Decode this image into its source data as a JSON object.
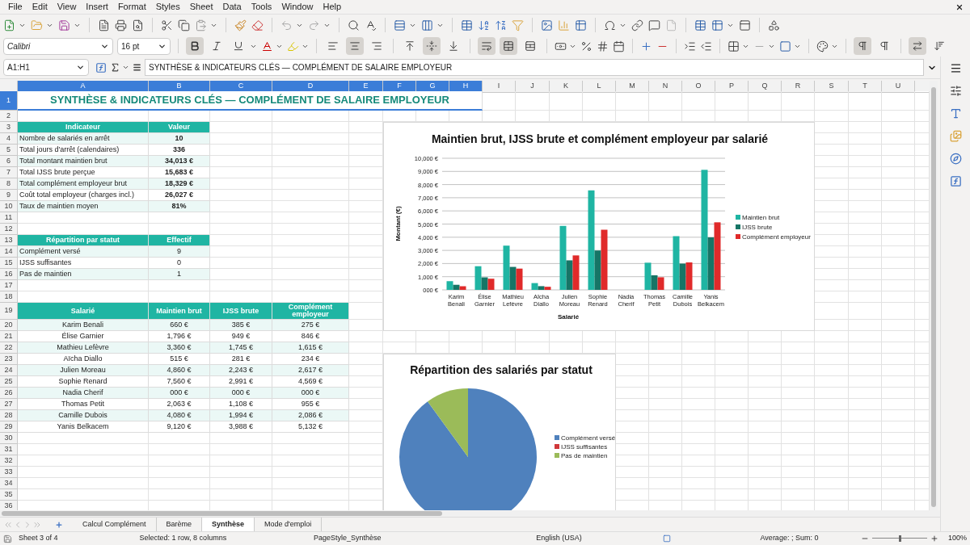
{
  "menu": [
    "File",
    "Edit",
    "View",
    "Insert",
    "Format",
    "Styles",
    "Sheet",
    "Data",
    "Tools",
    "Window",
    "Help"
  ],
  "font_name": "Calibri",
  "font_size": "16 pt",
  "format_buttons": [
    {
      "kind": "bold",
      "pressed": true
    },
    {
      "kind": "italic",
      "pressed": false
    },
    {
      "kind": "underline",
      "pressed": false
    },
    {
      "kind": "align_left",
      "pressed": false
    },
    {
      "kind": "align_center",
      "pressed": true
    },
    {
      "kind": "align_right",
      "pressed": false
    },
    {
      "kind": "align_top",
      "pressed": false
    },
    {
      "kind": "align_middle",
      "pressed": true
    },
    {
      "kind": "align_bottom",
      "pressed": false
    },
    {
      "kind": "wrap",
      "pressed": true
    },
    {
      "kind": "merge",
      "pressed": true
    },
    {
      "kind": "unmerge",
      "pressed": false
    },
    {
      "kind": "ltr",
      "pressed": true
    },
    {
      "kind": "rtl",
      "pressed": false
    },
    {
      "kind": "text_ltr",
      "pressed": true
    },
    {
      "kind": "text_ttb",
      "pressed": false
    }
  ],
  "name_box": "A1:H1",
  "formula": "SYNTHÈSE & INDICATEURS CLÉS — COMPLÉMENT DE SALAIRE EMPLOYEUR",
  "columns": [
    {
      "label": "A",
      "selected": true
    },
    {
      "label": "B",
      "selected": true
    },
    {
      "label": "C",
      "selected": true
    },
    {
      "label": "D",
      "selected": true
    },
    {
      "label": "E",
      "selected": true
    },
    {
      "label": "F",
      "selected": true
    },
    {
      "label": "G",
      "selected": true
    },
    {
      "label": "H",
      "selected": true
    },
    {
      "label": "I",
      "selected": false
    },
    {
      "label": "J",
      "selected": false
    },
    {
      "label": "K",
      "selected": false
    },
    {
      "label": "L",
      "selected": false
    },
    {
      "label": "M",
      "selected": false
    },
    {
      "label": "N",
      "selected": false
    },
    {
      "label": "O",
      "selected": false
    },
    {
      "label": "P",
      "selected": false
    },
    {
      "label": "Q",
      "selected": false
    },
    {
      "label": "R",
      "selected": false
    },
    {
      "label": "S",
      "selected": false
    },
    {
      "label": "T",
      "selected": false
    },
    {
      "label": "U",
      "selected": false
    }
  ],
  "rows": [
    {
      "label": "1",
      "selected": true
    },
    {
      "label": "2",
      "selected": false
    },
    {
      "label": "3",
      "selected": false
    },
    {
      "label": "4",
      "selected": false
    },
    {
      "label": "5",
      "selected": false
    },
    {
      "label": "6",
      "selected": false
    },
    {
      "label": "7",
      "selected": false
    },
    {
      "label": "8",
      "selected": false
    },
    {
      "label": "9",
      "selected": false
    },
    {
      "label": "10",
      "selected": false
    },
    {
      "label": "11",
      "selected": false
    },
    {
      "label": "12",
      "selected": false
    },
    {
      "label": "13",
      "selected": false
    },
    {
      "label": "14",
      "selected": false
    },
    {
      "label": "15",
      "selected": false
    },
    {
      "label": "16",
      "selected": false
    },
    {
      "label": "17",
      "selected": false
    },
    {
      "label": "18",
      "selected": false
    },
    {
      "label": "19",
      "selected": false
    },
    {
      "label": "20",
      "selected": false
    },
    {
      "label": "21",
      "selected": false
    },
    {
      "label": "22",
      "selected": false
    },
    {
      "label": "23",
      "selected": false
    },
    {
      "label": "24",
      "selected": false
    },
    {
      "label": "25",
      "selected": false
    },
    {
      "label": "26",
      "selected": false
    },
    {
      "label": "27",
      "selected": false
    },
    {
      "label": "28",
      "selected": false
    },
    {
      "label": "29",
      "selected": false
    },
    {
      "label": "30",
      "selected": false
    },
    {
      "label": "31",
      "selected": false
    },
    {
      "label": "32",
      "selected": false
    },
    {
      "label": "33",
      "selected": false
    },
    {
      "label": "34",
      "selected": false
    },
    {
      "label": "35",
      "selected": false
    },
    {
      "label": "36",
      "selected": false
    }
  ],
  "title": "SYNTHÈSE & INDICATEURS CLÉS — COMPLÉMENT DE SALAIRE EMPLOYEUR",
  "indicators": {
    "header": [
      "Indicateur",
      "Valeur"
    ],
    "rows": [
      {
        "label": "Nombre de salariés en arrêt",
        "value": "10"
      },
      {
        "label": "Total jours d'arrêt (calendaires)",
        "value": "336"
      },
      {
        "label": "Total montant maintien brut",
        "value": "34,013 €"
      },
      {
        "label": "Total IJSS brute perçue",
        "value": "15,683 €"
      },
      {
        "label": "Total complément employeur brut",
        "value": "18,329 €"
      },
      {
        "label": "Coût total employeur (charges incl.)",
        "value": "26,027 €"
      },
      {
        "label": "Taux de maintien moyen",
        "value": "81%"
      }
    ]
  },
  "status_table": {
    "header": [
      "Répartition par statut",
      "Effectif"
    ],
    "rows": [
      {
        "label": "Complément versé",
        "value": "9"
      },
      {
        "label": "IJSS suffisantes",
        "value": "0"
      },
      {
        "label": "Pas de maintien",
        "value": "1"
      }
    ]
  },
  "salaries": {
    "header": [
      "Salarié",
      "Maintien brut",
      "IJSS brute",
      "Complément employeur"
    ],
    "rows": [
      [
        "Karim Benali",
        "660 €",
        "385 €",
        "275 €"
      ],
      [
        "Élise Garnier",
        "1,796 €",
        "949 €",
        "846 €"
      ],
      [
        "Mathieu Lefèvre",
        "3,360 €",
        "1,745 €",
        "1,615 €"
      ],
      [
        "Aïcha Diallo",
        "515 €",
        "281 €",
        "234 €"
      ],
      [
        "Julien Moreau",
        "4,860 €",
        "2,243 €",
        "2,617 €"
      ],
      [
        "Sophie Renard",
        "7,560 €",
        "2,991 €",
        "4,569 €"
      ],
      [
        "Nadia Cherif",
        "000 €",
        "000 €",
        "000 €"
      ],
      [
        "Thomas Petit",
        "2,063 €",
        "1,108 €",
        "955 €"
      ],
      [
        "Camille Dubois",
        "4,080 €",
        "1,994 €",
        "2,086 €"
      ],
      [
        "Yanis Belkacem",
        "9,120 €",
        "3,988 €",
        "5,132 €"
      ]
    ]
  },
  "bar_chart": {
    "chart_data": {
      "type": "bar",
      "title": "Maintien brut, IJSS brute et complément employeur par salarié",
      "xlabel": "Salarié",
      "ylabel": "Montant (€)",
      "categories": [
        [
          "Karim",
          "Benali"
        ],
        [
          "Élise",
          "Garnier"
        ],
        [
          "Mathieu",
          "Lefèvre"
        ],
        [
          "Aïcha",
          "Diallo"
        ],
        [
          "Julien",
          "Moreau"
        ],
        [
          "Sophie",
          "Renard"
        ],
        [
          "Nadia",
          "Cherif"
        ],
        [
          "Thomas",
          "Petit"
        ],
        [
          "Camille",
          "Dubois"
        ],
        [
          "Yanis",
          "Belkacem"
        ]
      ],
      "series": [
        {
          "name": "Maintien brut",
          "color": "#1fb5a3",
          "values": [
            660,
            1796,
            3360,
            515,
            4860,
            7560,
            0,
            2063,
            4080,
            9120
          ]
        },
        {
          "name": "IJSS brute",
          "color": "#167566",
          "values": [
            385,
            949,
            1745,
            281,
            2243,
            2991,
            0,
            1108,
            1994,
            3988
          ]
        },
        {
          "name": "Complément employeur",
          "color": "#e02a2a",
          "values": [
            275,
            846,
            1615,
            234,
            2617,
            4569,
            0,
            955,
            2086,
            5132
          ]
        }
      ],
      "ylim": [
        0,
        10000
      ],
      "grid": true,
      "legend": "right",
      "yticks": [
        {
          "value": 0,
          "label": "000 €"
        },
        {
          "value": 1000,
          "label": "1,000 €"
        },
        {
          "value": 2000,
          "label": "2,000 €"
        },
        {
          "value": 3000,
          "label": "3,000 €"
        },
        {
          "value": 4000,
          "label": "4,000 €"
        },
        {
          "value": 5000,
          "label": "5,000 €"
        },
        {
          "value": 6000,
          "label": "6,000 €"
        },
        {
          "value": 7000,
          "label": "7,000 €"
        },
        {
          "value": 8000,
          "label": "8,000 €"
        },
        {
          "value": 9000,
          "label": "9,000 €"
        },
        {
          "value": 10000,
          "label": "10,000 €"
        }
      ]
    }
  },
  "pie_chart": {
    "chart_data": {
      "type": "pie",
      "title": "Répartition des salariés par statut",
      "categories": [
        "Complément versé",
        "IJSS suffisantes",
        "Pas de maintien"
      ],
      "colors": [
        "#4f81bd",
        "#d0383a",
        "#9bbb59"
      ],
      "values": [
        90,
        0,
        10
      ],
      "legend": "right"
    }
  },
  "sheet_tabs": [
    {
      "label": "Calcul Complément",
      "selected": false
    },
    {
      "label": "Barème",
      "selected": false
    },
    {
      "label": "Synthèse",
      "selected": true
    },
    {
      "label": "Mode d'emploi",
      "selected": false
    }
  ],
  "status_bar": {
    "sheet": "Sheet 3 of 4",
    "selection": "Selected: 1 row, 8 columns",
    "page_style": "PageStyle_Synthèse",
    "language": "English (USA)",
    "sum": "Average: ; Sum: 0",
    "zoom": "100%",
    "zoom_level": {
      "level": 0.5
    }
  }
}
